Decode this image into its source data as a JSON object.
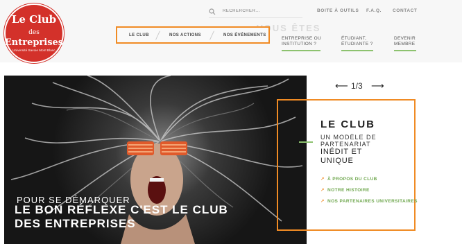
{
  "logo": {
    "line1_main": "Le Club",
    "line1_small": "des",
    "line2": "Entreprises",
    "line3": "Université Savoie Mont Blanc"
  },
  "search": {
    "placeholder": "RECHERCHER..."
  },
  "utility_nav": [
    "BOITE À OUTILS",
    "F.A.Q.",
    "CONTACT"
  ],
  "watermark": "VOUS ÊTES",
  "main_nav": [
    "LE CLUB",
    "NOS ACTIONS",
    "NOS ÉVÉNEMENTS"
  ],
  "audience": [
    {
      "line1": "ENTREPRISE OU",
      "line2": "INSTITUTION ?"
    },
    {
      "line1": "ÉTUDIANT,",
      "line2": "ÉTUDIANTE ?"
    },
    {
      "line1": "DEVENIR",
      "line2": "MEMBRE"
    }
  ],
  "hero": {
    "kicker": "POUR SE DÉMARQUER",
    "headline": "LE BON RÉFLEXE C'EST LE CLUB DES ENTREPRISES"
  },
  "slider": {
    "counter": "1/3"
  },
  "panel": {
    "title": "LE CLUB",
    "subtitle_line1": "UN MODÈLE DE",
    "subtitle_line2": "PARTENARIAT",
    "subtitle_line3": "INÉDIT ET",
    "subtitle_line4": "UNIQUE",
    "links": [
      "À PROPOS DU CLUB",
      "NOTRE HISTOIRE",
      "NOS PARTENAIRES UNIVERSITAIRES"
    ]
  },
  "colors": {
    "accent": "#f08b24",
    "green": "#8dc26f",
    "logo_red": "#d3312a"
  },
  "icons": {
    "search": "search-icon",
    "prev": "arrow-left-icon",
    "next": "arrow-right-icon",
    "link": "arrow-icon"
  }
}
